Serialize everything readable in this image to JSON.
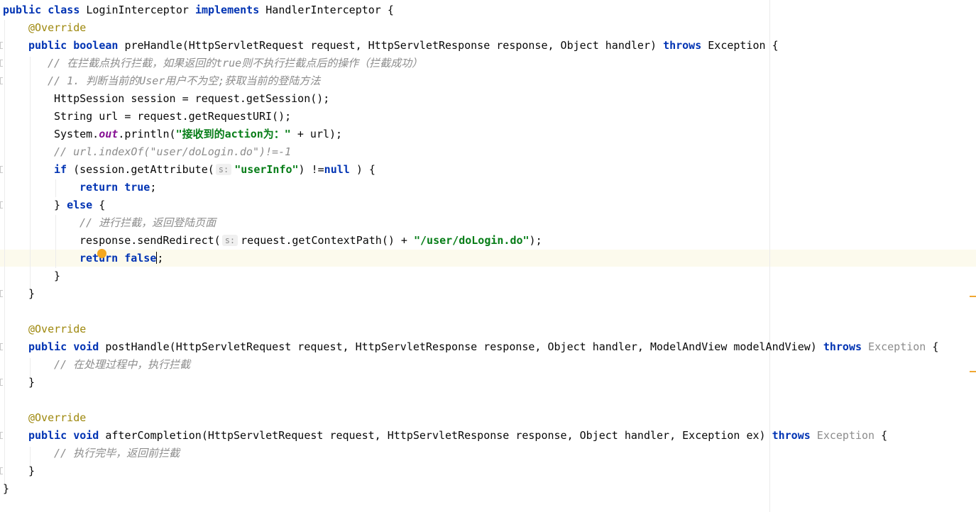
{
  "colors": {
    "keyword": "#0033b3",
    "annotation": "#9e880d",
    "string": "#067d17",
    "comment": "#8c8c8c",
    "static_field": "#871094",
    "current_line": "#fcfaed",
    "bulb": "#f4a71e"
  },
  "icons": {
    "bulb": "intention-bulb-icon",
    "scroll_marks": "warning-stripe-icon"
  },
  "code": {
    "l1": {
      "kw1": "public",
      "kw2": "class",
      "name": " LoginInterceptor ",
      "kw3": "implements",
      "rest": " HandlerInterceptor {"
    },
    "l2": {
      "anno": "@Override"
    },
    "l3": {
      "kw1": "public",
      "kw2": "boolean",
      "sig": " preHandle(HttpServletRequest request, HttpServletResponse response, Object handler) ",
      "kw3": "throws",
      "rest": " Exception {"
    },
    "l4": {
      "cmt": "// 在拦截点执行拦截，如果返回的true则不执行拦截点后的操作（拦截成功）"
    },
    "l5": {
      "cmt": "// 1. 判断当前的User用户不为空;获取当前的登陆方法"
    },
    "l6": {
      "text": "HttpSession session = request.getSession();"
    },
    "l7": {
      "text": "String url = request.getRequestURI();"
    },
    "l8": {
      "pre": "System.",
      "field": "out",
      "mid": ".println(",
      "str": "\"接收到的action为：\"",
      "post": " + url);"
    },
    "l9": {
      "cmt": "// url.indexOf(\"user/doLogin.do\")!=-1"
    },
    "l10": {
      "kw": "if",
      "pre": " (session.getAttribute(",
      "hint": "s:",
      "str": "\"userInfo\"",
      "mid": ") !=",
      "kw2": "null",
      "post": " ) {"
    },
    "l11": {
      "kw1": "return",
      "kw2": "true",
      "post": ";"
    },
    "l12": {
      "pre": "} ",
      "kw": "else",
      "post": " {"
    },
    "l13": {
      "cmt": "// 进行拦截，返回登陆页面"
    },
    "l14": {
      "pre": "response.sendRedirect(",
      "hint": "s:",
      "mid": "request.getContextPath() + ",
      "str": "\"/user/doLogin.do\"",
      "post": ");"
    },
    "l15": {
      "kw1": "return",
      "kw2": "false",
      "post": ";"
    },
    "l16": {
      "text": "}"
    },
    "l17": {
      "text": "}"
    },
    "l18": {
      "anno": "@Override"
    },
    "l19": {
      "kw1": "public",
      "kw2": "void",
      "sig": " postHandle(HttpServletRequest request, HttpServletResponse response, Object handler, ModelAndView modelAndView) ",
      "kw3": "throws",
      "unused": " Exception",
      "rest": " {"
    },
    "l20": {
      "cmt": "// 在处理过程中，执行拦截"
    },
    "l21": {
      "text": "}"
    },
    "l22": {
      "anno": "@Override"
    },
    "l23": {
      "kw1": "public",
      "kw2": "void",
      "sig": " afterCompletion(HttpServletRequest request, HttpServletResponse response, Object handler, Exception ex) ",
      "kw3": "throws",
      "unused": " Exception",
      "rest": " {"
    },
    "l24": {
      "cmt": "// 执行完毕，返回前拦截"
    },
    "l25": {
      "text": "}"
    },
    "l26": {
      "text": "}"
    }
  }
}
